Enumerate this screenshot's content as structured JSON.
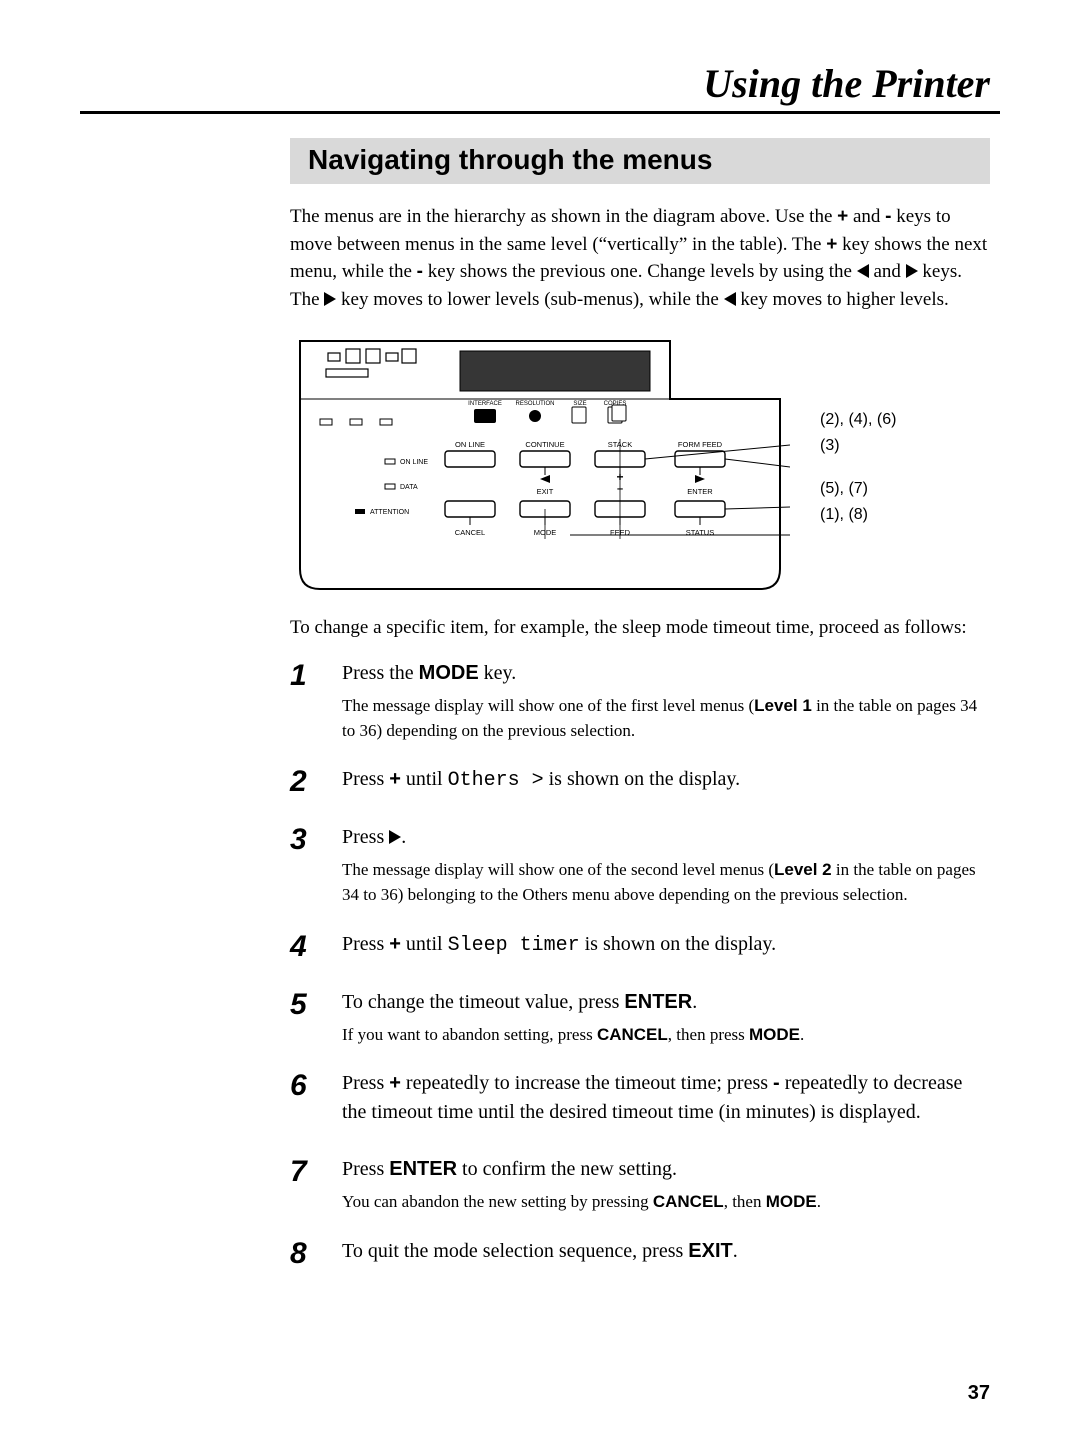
{
  "header": {
    "title": "Using the Printer"
  },
  "section": {
    "heading": "Navigating through the menus"
  },
  "intro": {
    "part1": "The menus are in the hierarchy as shown in the diagram above. Use the ",
    "plus1": "+",
    "part2": " and ",
    "minus1": "-",
    "part3": " keys to move between menus in the same level (“vertically” in the table). The ",
    "plus2": "+",
    "part4": " key shows the next menu, while the ",
    "minus2": "-",
    "part5": " key shows the previous one. Change levels by using the ",
    "part6": " and ",
    "part7": " keys.  The ",
    "part8": " key moves to lower levels (sub-menus), while the ",
    "part9": " key moves to higher levels."
  },
  "panel": {
    "labels": {
      "interface": "INTERFACE",
      "resolution": "RESOLUTION",
      "size": "SIZE",
      "copies": "COPIES",
      "online_btn": "ON LINE",
      "continue": "CONTINUE",
      "stack": "STACK",
      "formfeed": "FORM FEED",
      "exit": "EXIT",
      "enter": "ENTER",
      "cancel": "CANCEL",
      "mode": "MODE",
      "feed": "FEED",
      "status": "STATUS",
      "onlineled": "ON LINE",
      "data": "DATA",
      "attention": "ATTENTION",
      "plus": "+",
      "minus": "–"
    },
    "annotations": {
      "r1": "(2), (4), (6)",
      "r2": "(3)",
      "r3": "(5), (7)",
      "r4": "(1), (8)"
    }
  },
  "leadin": "To change a specific item, for example, the sleep mode timeout time, proceed as follows:",
  "steps": {
    "s1": {
      "num": "1",
      "main_a": "Press the ",
      "key": "MODE",
      "main_b": " key.",
      "sub_a": "The message display will show one of the first level menus (",
      "lvl": "Level 1",
      "sub_b": " in the table on pages 34 to 36) depending on the previous selection."
    },
    "s2": {
      "num": "2",
      "main_a": "Press ",
      "plus": "+",
      "main_b": " until ",
      "code": "Others  >",
      "main_c": " is shown on the display."
    },
    "s3": {
      "num": "3",
      "main_a": "Press ",
      "main_b": ".",
      "sub_a": "The message display will show one of the second level menus (",
      "lvl": "Level 2",
      "sub_b": " in the table on pages 34 to 36) belonging to the Others menu above depending on the previous selection."
    },
    "s4": {
      "num": "4",
      "main_a": "Press ",
      "plus": "+",
      "main_b": " until ",
      "code": "Sleep timer",
      "main_c": " is shown on the display."
    },
    "s5": {
      "num": "5",
      "main_a": "To change the timeout value, press ",
      "key": "ENTER",
      "main_b": ".",
      "sub_a": " If you want to abandon setting, press ",
      "k1": "CANCEL",
      "sub_b": ", then press ",
      "k2": "MODE",
      "sub_c": "."
    },
    "s6": {
      "num": "6",
      "main_a": "Press ",
      "plus": "+",
      "main_b": " repeatedly to increase the timeout time; press ",
      "minus": "-",
      "main_c": " repeatedly to decrease the timeout time until the desired timeout time (in minutes) is displayed."
    },
    "s7": {
      "num": "7",
      "main_a": "Press ",
      "key": "ENTER",
      "main_b": " to confirm the new setting.",
      "sub_a": " You can abandon the new setting by pressing ",
      "k1": "CANCEL",
      "sub_b": ", then ",
      "k2": "MODE",
      "sub_c": "."
    },
    "s8": {
      "num": "8",
      "main_a": "To quit the mode selection sequence, press ",
      "key": "EXIT",
      "main_b": "."
    }
  },
  "page_number": "37"
}
